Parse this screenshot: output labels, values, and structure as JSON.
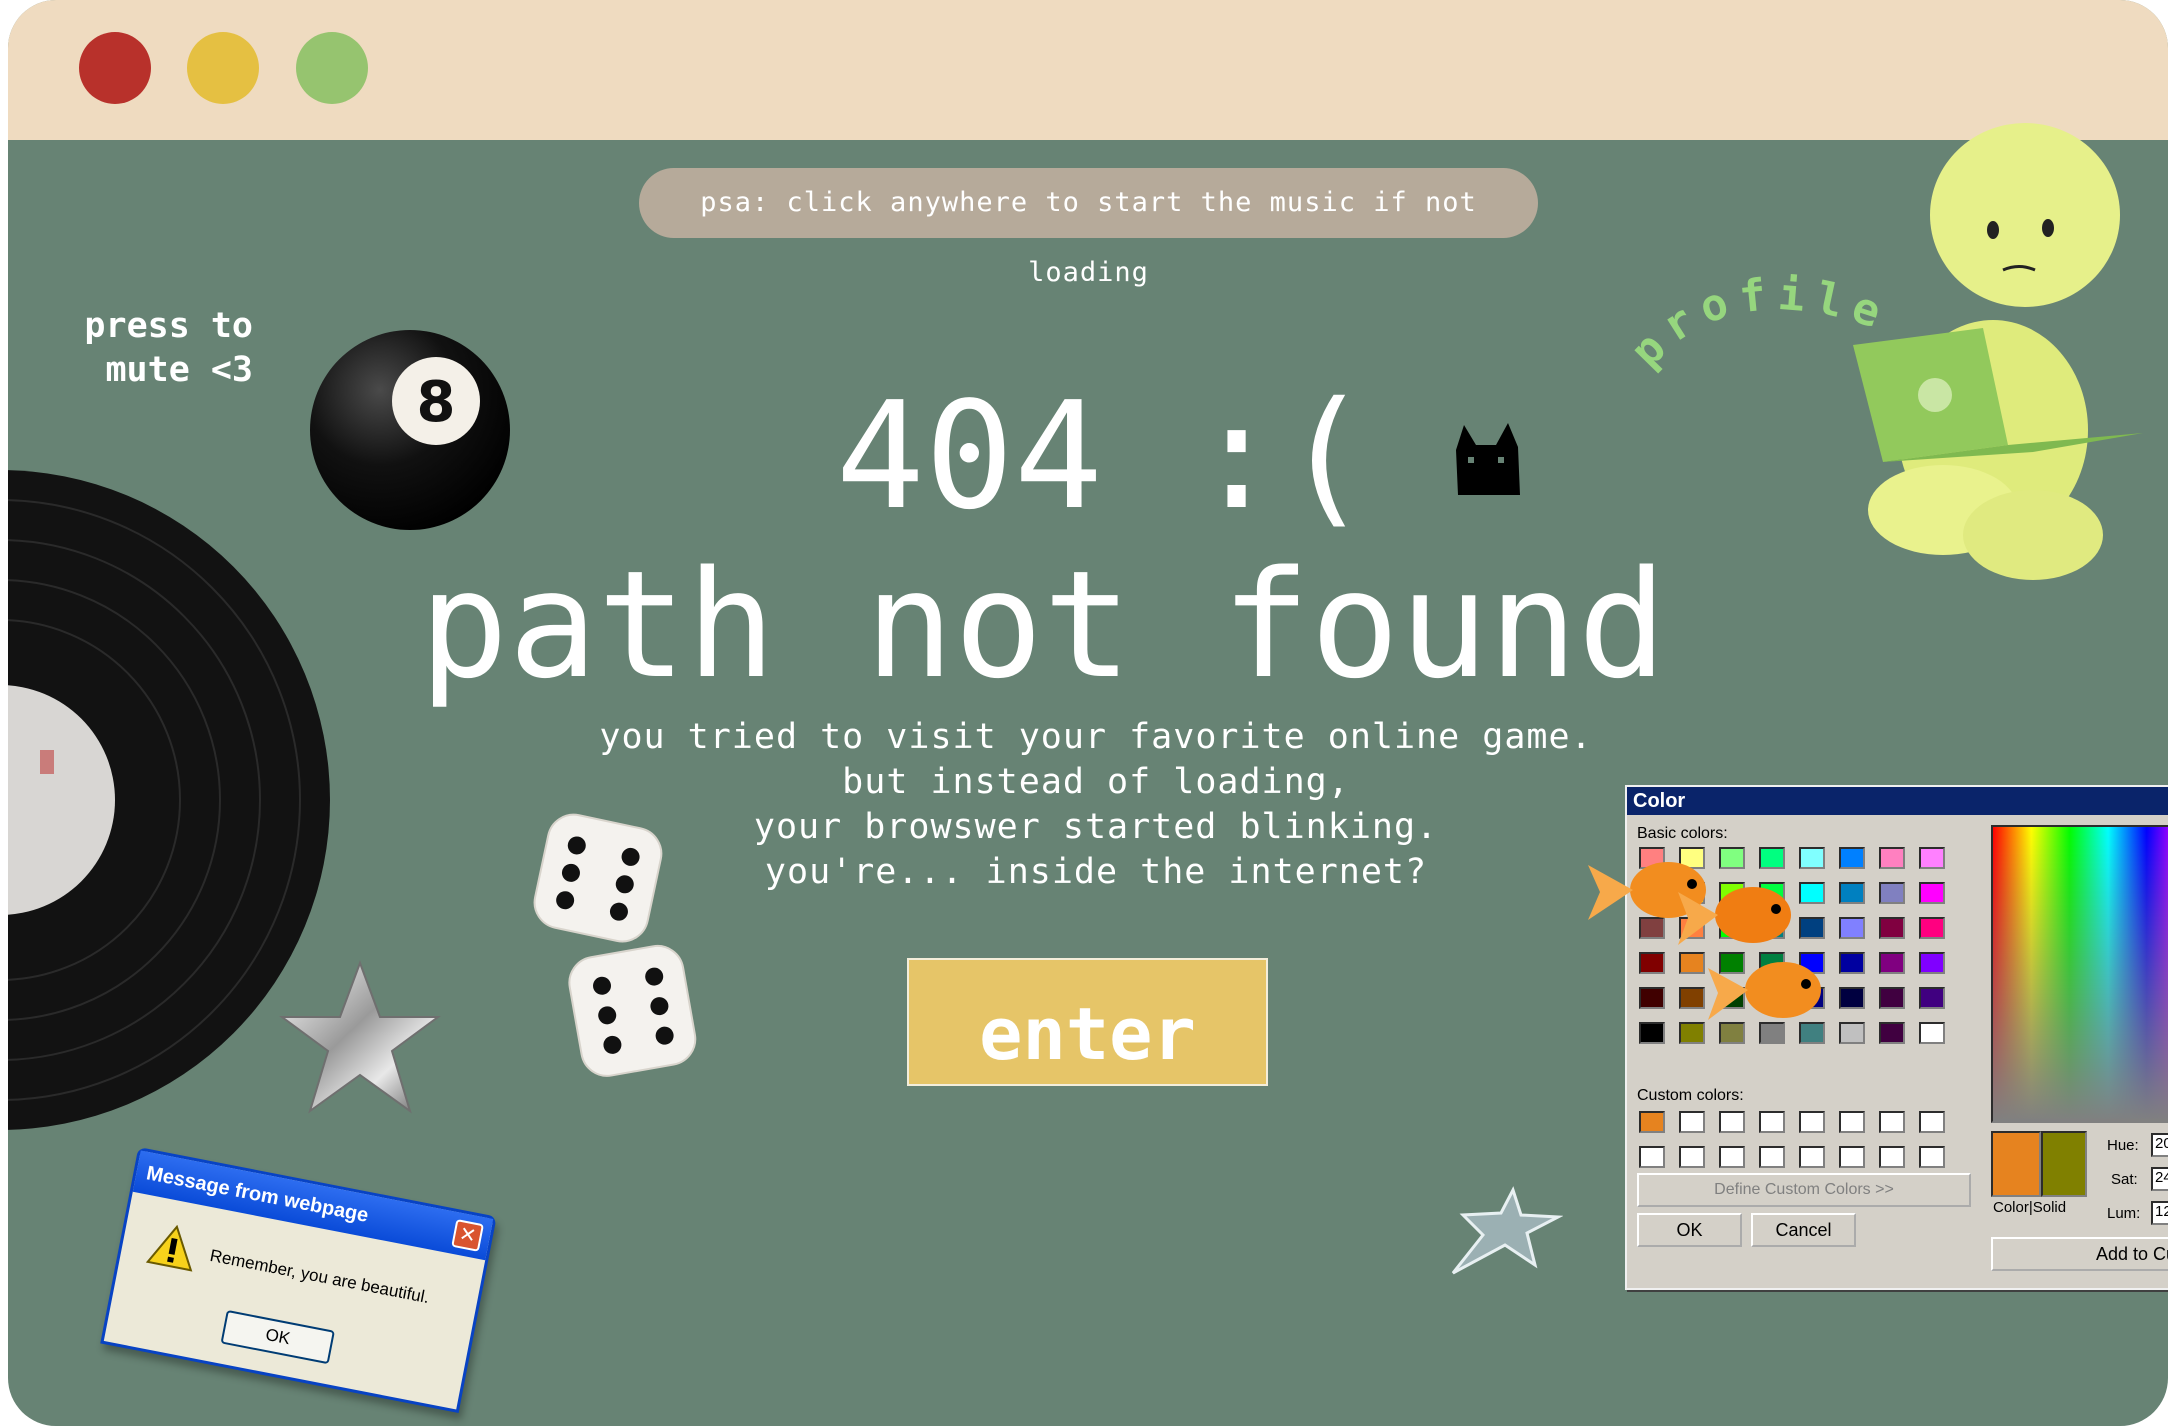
{
  "window": {
    "controls": [
      {
        "name": "close",
        "color": "#b8312b"
      },
      {
        "name": "minimize",
        "color": "#e5c042"
      },
      {
        "name": "maximize",
        "color": "#96c46f"
      }
    ],
    "background": "#678374",
    "titlebar_color": "#efdbc0"
  },
  "psa": "psa: click anywhere to start the music if not loading",
  "mute": {
    "line1": "press to",
    "line2": "mute <3"
  },
  "title": {
    "code": "404 :(",
    "headline": "path not found"
  },
  "message": {
    "line1": "you tried to visit your favorite online game.",
    "line2": "but instead of loading,",
    "line3": "your browswer started blinking.",
    "line4": "you're... inside the internet?"
  },
  "enter_button": {
    "label": "enter",
    "color": "#e6c568"
  },
  "profile_link": {
    "label": "profile",
    "color": "#96d67e"
  },
  "eight_ball": {
    "label": "8"
  },
  "color_dialog": {
    "title": "Color",
    "basic_colors_label": "Basic colors:",
    "custom_colors_label": "Custom colors:",
    "define_button": "Define Custom Colors >>",
    "ok_button": "OK",
    "cancel_button": "Cancel",
    "add_button": "Add to Cus",
    "color_solid_label": "Color|Solid",
    "hue_label": "Hue:",
    "hue_value": "20",
    "sat_label": "Sat:",
    "sat_value": "24",
    "lum_label": "Lum:",
    "lum_value": "12",
    "basic_colors": [
      "#ff8080",
      "#ffff80",
      "#80ff80",
      "#00ff80",
      "#80ffff",
      "#0080ff",
      "#ff80c0",
      "#ff80ff",
      "#ff0000",
      "#ffff00",
      "#80ff00",
      "#00ff40",
      "#00ffff",
      "#0080c0",
      "#8080c0",
      "#ff00ff",
      "#804040",
      "#ff8040",
      "#00ff00",
      "#008080",
      "#004080",
      "#8080ff",
      "#800040",
      "#ff0080",
      "#800000",
      "#e6831f",
      "#008000",
      "#008040",
      "#0000ff",
      "#0000a0",
      "#800080",
      "#8000ff",
      "#400000",
      "#804000",
      "#004000",
      "#004040",
      "#000080",
      "#000040",
      "#400040",
      "#400080",
      "#000000",
      "#808000",
      "#808040",
      "#808080",
      "#408080",
      "#c0c0c0",
      "#400040",
      "#ffffff"
    ],
    "custom_colors": [
      "#e6831f",
      "#ffffff",
      "#ffffff",
      "#ffffff",
      "#ffffff",
      "#ffffff",
      "#ffffff",
      "#ffffff",
      "#ffffff",
      "#ffffff",
      "#ffffff",
      "#ffffff",
      "#ffffff",
      "#ffffff",
      "#ffffff",
      "#ffffff"
    ],
    "preview_color": "#e6831f",
    "preview_solid": "#808000"
  },
  "message_box": {
    "title": "Message from webpage",
    "text": "Remember, you are beautiful.",
    "ok_button": "OK"
  },
  "icons": [
    "vinyl-record-icon",
    "eight-ball-icon",
    "dice-icon",
    "chrome-star-icon",
    "black-cat-icon",
    "goldfish-icon",
    "figure-with-laptop-icon",
    "warning-icon",
    "close-icon"
  ]
}
